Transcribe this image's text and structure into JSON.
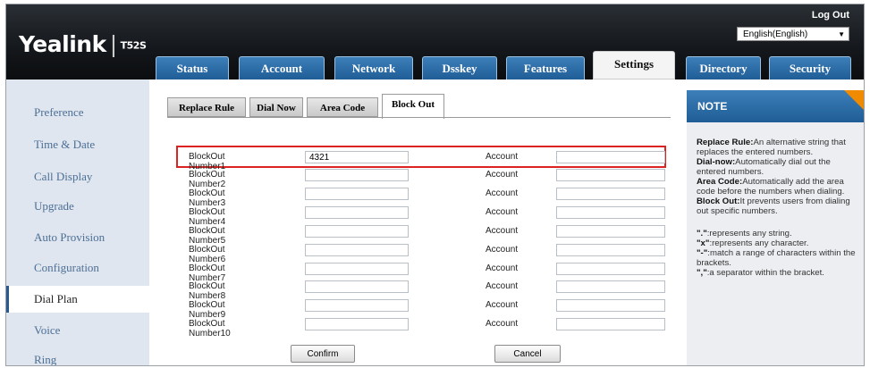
{
  "header": {
    "brand": "Yealink",
    "separator": "|",
    "model": "T52S",
    "logout": "Log Out",
    "language": "English(English)"
  },
  "top_tabs": [
    {
      "label": "Status"
    },
    {
      "label": "Account"
    },
    {
      "label": "Network"
    },
    {
      "label": "Dsskey"
    },
    {
      "label": "Features"
    },
    {
      "label": "Settings",
      "active": true
    },
    {
      "label": "Directory"
    },
    {
      "label": "Security"
    }
  ],
  "sidebar": {
    "items": [
      {
        "label": "Preference"
      },
      {
        "label": "Time & Date"
      },
      {
        "label": "Call Display"
      },
      {
        "label": "Upgrade"
      },
      {
        "label": "Auto Provision"
      },
      {
        "label": "Configuration"
      },
      {
        "label": "Dial Plan",
        "active": true
      },
      {
        "label": "Voice"
      },
      {
        "label": "Ring"
      }
    ]
  },
  "sub_tabs": [
    {
      "label": "Replace Rule"
    },
    {
      "label": "Dial Now"
    },
    {
      "label": "Area Code"
    },
    {
      "label": "Block Out",
      "active": true
    }
  ],
  "block_out": {
    "account_label": "Account",
    "rows": [
      {
        "label": "BlockOut Number1",
        "value": "4321"
      },
      {
        "label": "BlockOut Number2",
        "value": ""
      },
      {
        "label": "BlockOut Number3",
        "value": ""
      },
      {
        "label": "BlockOut Number4",
        "value": ""
      },
      {
        "label": "BlockOut Number5",
        "value": ""
      },
      {
        "label": "BlockOut Number6",
        "value": ""
      },
      {
        "label": "BlockOut Number7",
        "value": ""
      },
      {
        "label": "BlockOut Number8",
        "value": ""
      },
      {
        "label": "BlockOut Number9",
        "value": ""
      },
      {
        "label": "BlockOut Number10",
        "value": ""
      }
    ],
    "confirm_label": "Confirm",
    "cancel_label": "Cancel"
  },
  "note": {
    "title": "NOTE",
    "definitions": [
      {
        "term": "Replace Rule:",
        "text": "An alternative string that replaces the entered numbers."
      },
      {
        "term": "Dial-now:",
        "text": "Automatically dial out the entered numbers."
      },
      {
        "term": "Area Code:",
        "text": "Automatically add the area code before the numbers when dialing."
      },
      {
        "term": "Block Out:",
        "text": "It prevents users from dialing out specific numbers."
      }
    ],
    "symbols": [
      {
        "sym": "\".\"",
        "text": ":represents any string."
      },
      {
        "sym": "\"x\"",
        "text": ":represents any character."
      },
      {
        "sym": "\"-\"",
        "text": ":match a range of characters within the brackets."
      },
      {
        "sym": "\",\"",
        "text": ":a separator within the bracket."
      }
    ]
  },
  "colors": {
    "header_bg": "#14171b",
    "tab_blue": "#2f6fa9",
    "sidebar_bg": "#dfe6f0",
    "highlight_red": "#dd2222",
    "note_accent": "#f08a00"
  }
}
